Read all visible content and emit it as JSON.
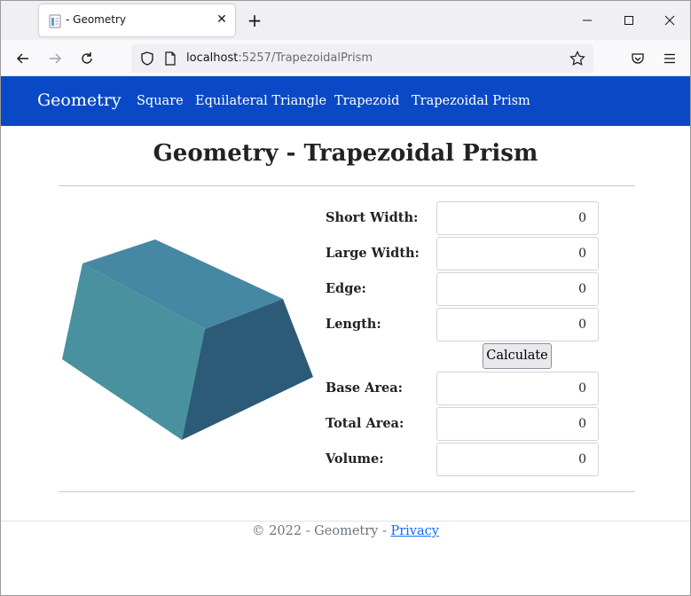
{
  "browser": {
    "tab_title": "- Geometry",
    "tab_close": "✕",
    "new_tab": "+",
    "url_host": "localhost",
    "url_path": ":5257/TrapezoidalPrism"
  },
  "site": {
    "brand": "Geometry",
    "nav": [
      "Square",
      "Equilateral Triangle",
      "Trapezoid",
      "Trapezoidal Prism"
    ]
  },
  "main": {
    "title": "Geometry - Trapezoidal Prism",
    "inputs": [
      {
        "label": "Short Width:",
        "value": "0"
      },
      {
        "label": "Large Width:",
        "value": "0"
      },
      {
        "label": "Edge:",
        "value": "0"
      },
      {
        "label": "Length:",
        "value": "0"
      }
    ],
    "calculate_label": "Calculate",
    "outputs": [
      {
        "label": "Base Area:",
        "value": "0"
      },
      {
        "label": "Total Area:",
        "value": "0"
      },
      {
        "label": "Volume:",
        "value": "0"
      }
    ]
  },
  "footer": {
    "text": "© 2022 - Geometry - ",
    "privacy": "Privacy"
  },
  "colors": {
    "nav_bg": "#0949c6",
    "prism_top": "#4687a4",
    "prism_front": "#49919e",
    "prism_side": "#2c5b78"
  }
}
